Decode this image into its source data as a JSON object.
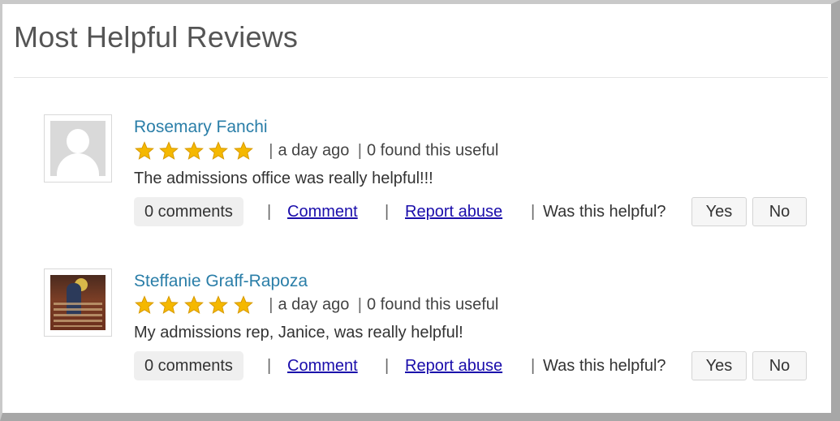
{
  "section": {
    "title": "Most Helpful Reviews"
  },
  "star_color": "#f5b800",
  "reviews": [
    {
      "name": "Rosemary Fanchi",
      "rating": 5,
      "time": "a day ago",
      "useful": "0 found this useful",
      "text": "The admissions office was really helpful!!!",
      "comments_label": "0 comments",
      "comment_link": "Comment",
      "report_link": "Report abuse",
      "helpful_question": "Was this helpful?",
      "yes_label": "Yes",
      "no_label": "No",
      "avatar": "default-user-avatar"
    },
    {
      "name": "Steffanie Graff-Rapoza",
      "rating": 5,
      "time": "a day ago",
      "useful": "0 found this useful",
      "text": "My admissions rep, Janice, was really helpful!",
      "comments_label": "0 comments",
      "comment_link": "Comment",
      "report_link": "Report abuse",
      "helpful_question": "Was this helpful?",
      "yes_label": "Yes",
      "no_label": "No",
      "avatar": "photo-avatar"
    }
  ],
  "separator": "|"
}
